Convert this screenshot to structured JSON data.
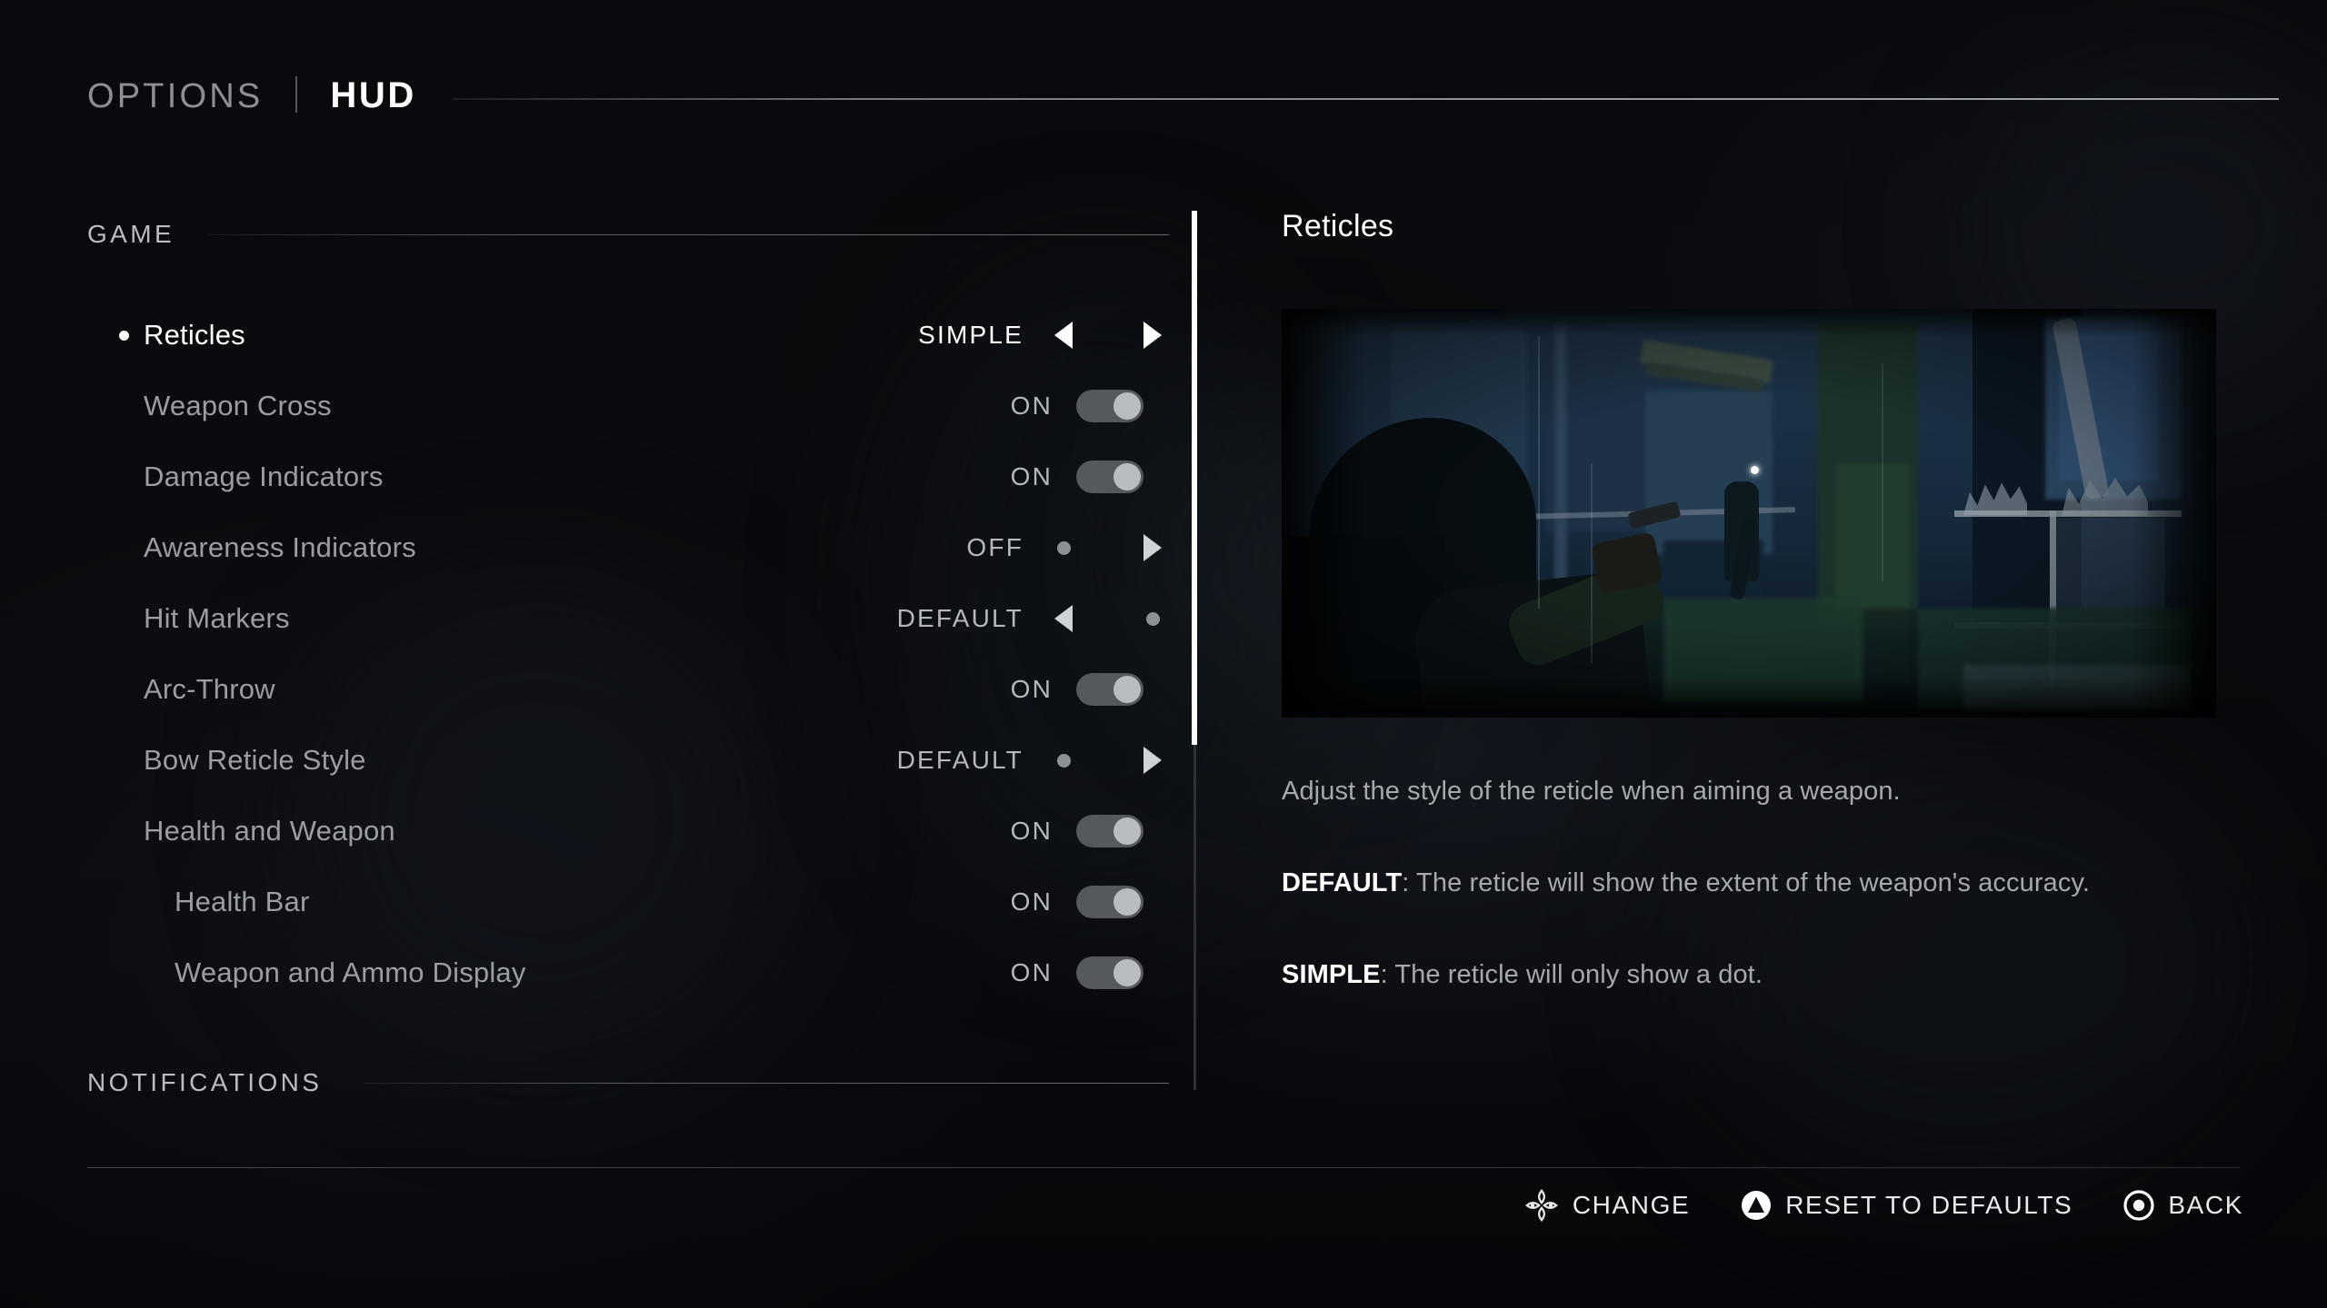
{
  "header": {
    "tab_options": "OPTIONS",
    "tab_hud": "HUD"
  },
  "sections": {
    "game": "GAME",
    "notifications": "NOTIFICATIONS"
  },
  "settings": [
    {
      "label": "Reticles",
      "value": "SIMPLE",
      "type": "stepper",
      "left": "arrow",
      "right": "arrow",
      "selected": true,
      "indent": false
    },
    {
      "label": "Weapon Cross",
      "value": "ON",
      "type": "toggle",
      "state": "on",
      "selected": false,
      "indent": false
    },
    {
      "label": "Damage Indicators",
      "value": "ON",
      "type": "toggle",
      "state": "on",
      "selected": false,
      "indent": false
    },
    {
      "label": "Awareness Indicators",
      "value": "OFF",
      "type": "stepper",
      "left": "dot",
      "right": "arrow",
      "selected": false,
      "indent": false
    },
    {
      "label": "Hit Markers",
      "value": "DEFAULT",
      "type": "stepper",
      "left": "arrow",
      "right": "dot",
      "selected": false,
      "indent": false
    },
    {
      "label": "Arc-Throw",
      "value": "ON",
      "type": "toggle",
      "state": "on",
      "selected": false,
      "indent": false
    },
    {
      "label": "Bow Reticle Style",
      "value": "DEFAULT",
      "type": "stepper",
      "left": "dot",
      "right": "arrow",
      "selected": false,
      "indent": false
    },
    {
      "label": "Health and Weapon",
      "value": "ON",
      "type": "toggle",
      "state": "on",
      "selected": false,
      "indent": false
    },
    {
      "label": "Health Bar",
      "value": "ON",
      "type": "toggle",
      "state": "on",
      "selected": false,
      "indent": true
    },
    {
      "label": "Weapon and Ammo Display",
      "value": "ON",
      "type": "toggle",
      "state": "on",
      "selected": false,
      "indent": true
    }
  ],
  "detail": {
    "title": "Reticles",
    "preview_alt": "reticle-preview-gameplay",
    "paragraphs": [
      {
        "lead": "",
        "text": "Adjust the style of the reticle when aiming a weapon."
      },
      {
        "lead": "DEFAULT",
        "text": ": The reticle will show the extent of the weapon's accuracy."
      },
      {
        "lead": "SIMPLE",
        "text": ": The reticle will only show a dot."
      }
    ]
  },
  "footer": [
    {
      "icon": "dpad-icon",
      "label": "CHANGE"
    },
    {
      "icon": "triangle-icon",
      "label": "RESET TO DEFAULTS"
    },
    {
      "icon": "circle-icon",
      "label": "BACK"
    }
  ],
  "colors": {
    "background": "#07080a",
    "text_primary": "#ffffff",
    "text_muted": "#9a9da1",
    "rule": "#9aa0a6",
    "toggle_on_track": "#55585c",
    "toggle_knob": "#b9bcc0",
    "scrollbar_thumb": "#ffffff"
  }
}
